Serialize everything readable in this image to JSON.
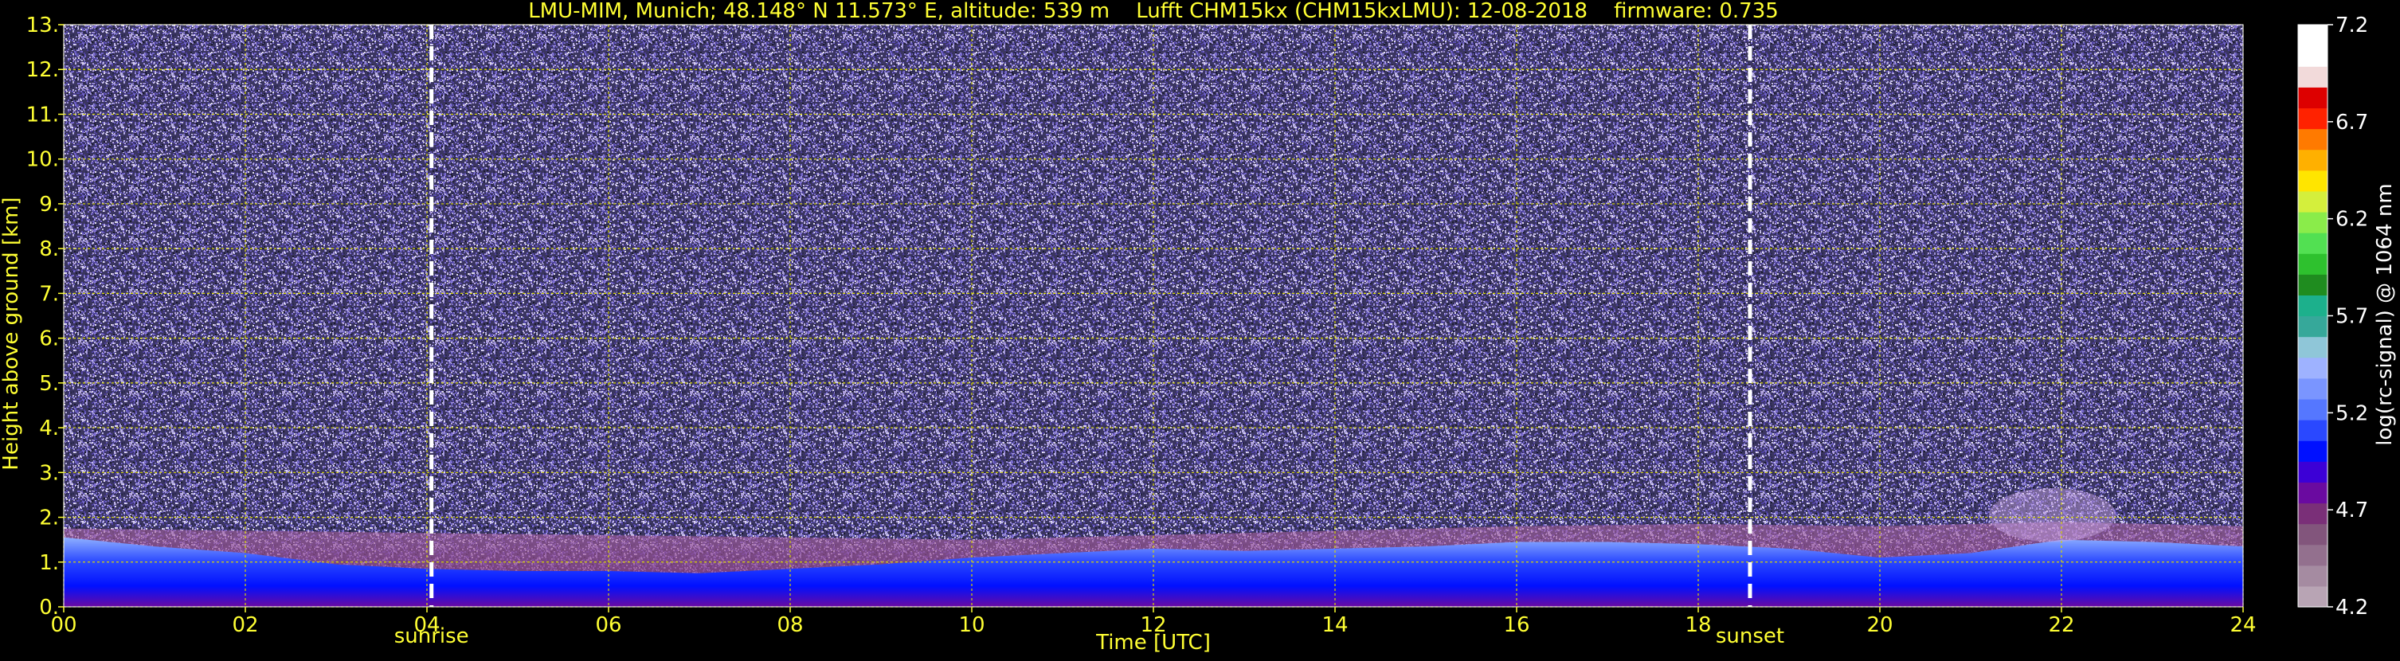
{
  "colors": {
    "background": "#000000",
    "text_primary": "#ffff33",
    "text_colorbar": "#ffffff",
    "grid": "#d8d800",
    "marker": "#ffffff"
  },
  "chart_data": {
    "type": "heatmap",
    "title": "LMU-MIM, Munich; 48.148° N 11.573° E, altitude: 539 m    Lufft CHM15kx (CHM15kxLMU): 12-08-2018    firmware: 0.735",
    "xlabel": "Time [UTC]",
    "ylabel": "Height above ground [km]",
    "xlim": [
      0,
      24
    ],
    "ylim": [
      0,
      13
    ],
    "x_ticks": [
      0,
      2,
      4,
      6,
      8,
      10,
      12,
      14,
      16,
      18,
      20,
      22,
      24
    ],
    "x_tick_labels": [
      "00",
      "02",
      "04",
      "06",
      "08",
      "10",
      "12",
      "14",
      "16",
      "18",
      "20",
      "22",
      "24"
    ],
    "y_ticks": [
      0,
      1,
      2,
      3,
      4,
      5,
      6,
      7,
      8,
      9,
      10,
      11,
      12,
      13
    ],
    "y_tick_labels": [
      "0.",
      "1.",
      "2.",
      "3.",
      "4.",
      "5.",
      "6.",
      "7.",
      "8.",
      "9.",
      "10.",
      "11.",
      "12.",
      "13."
    ],
    "grid": true,
    "markers": [
      {
        "label": "sunrise",
        "x": 4.05
      },
      {
        "label": "sunset",
        "x": 18.57
      }
    ],
    "colorbar": {
      "label": "log(rc-signal) @ 1064 nm",
      "range": [
        4.2,
        7.2
      ],
      "ticks": [
        4.2,
        4.7,
        5.2,
        5.7,
        6.2,
        6.7,
        7.2
      ],
      "tick_labels": [
        "4.2",
        "4.7",
        "5.2",
        "5.7",
        "6.2",
        "6.7",
        "7.2"
      ],
      "color_levels": [
        "#b8a4b4",
        "#a58ba1",
        "#93708e",
        "#82557c",
        "#7a2f78",
        "#6a0aa0",
        "#3c00d6",
        "#0010ff",
        "#2a48ff",
        "#5577ff",
        "#7a95ff",
        "#9eb2ff",
        "#8fc6d8",
        "#36a89a",
        "#1cb08c",
        "#1f8c1f",
        "#2ec12e",
        "#52e052",
        "#8aec4a",
        "#d4ef3c",
        "#ffe500",
        "#ffb000",
        "#ff7a00",
        "#ff2200",
        "#dd0000",
        "#f2dada",
        "#ffffff",
        "#ffffff"
      ]
    },
    "layers": {
      "noise_top_km": 13,
      "aerosol_layer_top_km": [
        {
          "x": 0,
          "y": 1.75
        },
        {
          "x": 2,
          "y": 1.7
        },
        {
          "x": 4,
          "y": 1.65
        },
        {
          "x": 6,
          "y": 1.6
        },
        {
          "x": 8,
          "y": 1.55
        },
        {
          "x": 10,
          "y": 1.5
        },
        {
          "x": 12,
          "y": 1.6
        },
        {
          "x": 14,
          "y": 1.7
        },
        {
          "x": 16,
          "y": 1.8
        },
        {
          "x": 18,
          "y": 1.85
        },
        {
          "x": 20,
          "y": 1.8
        },
        {
          "x": 22,
          "y": 1.9
        },
        {
          "x": 24,
          "y": 1.8
        }
      ],
      "boundary_layer_top_km": [
        {
          "x": 0,
          "y": 1.55
        },
        {
          "x": 1,
          "y": 1.35
        },
        {
          "x": 2,
          "y": 1.2
        },
        {
          "x": 3,
          "y": 0.95
        },
        {
          "x": 4,
          "y": 0.85
        },
        {
          "x": 5,
          "y": 0.8
        },
        {
          "x": 6,
          "y": 0.8
        },
        {
          "x": 7,
          "y": 0.75
        },
        {
          "x": 8,
          "y": 0.85
        },
        {
          "x": 9,
          "y": 0.95
        },
        {
          "x": 10,
          "y": 1.1
        },
        {
          "x": 11,
          "y": 1.2
        },
        {
          "x": 12,
          "y": 1.3
        },
        {
          "x": 13,
          "y": 1.25
        },
        {
          "x": 14,
          "y": 1.3
        },
        {
          "x": 15,
          "y": 1.35
        },
        {
          "x": 16,
          "y": 1.45
        },
        {
          "x": 17,
          "y": 1.45
        },
        {
          "x": 18,
          "y": 1.4
        },
        {
          "x": 19,
          "y": 1.3
        },
        {
          "x": 20,
          "y": 1.1
        },
        {
          "x": 21,
          "y": 1.2
        },
        {
          "x": 22,
          "y": 1.5
        },
        {
          "x": 23,
          "y": 1.45
        },
        {
          "x": 24,
          "y": 1.35
        }
      ],
      "residual_cloud_x": [
        21.2,
        22.6
      ],
      "residual_cloud_top_km": 2.4
    }
  }
}
